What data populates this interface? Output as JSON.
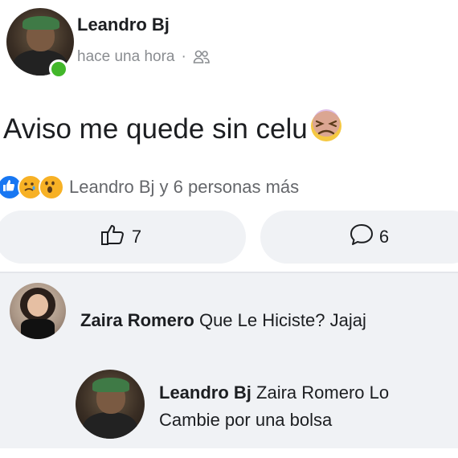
{
  "post": {
    "author": "Leandro Bj",
    "time": "hace una hora",
    "separator": "·",
    "audience_icon": "friends-icon",
    "text": "Aviso me quede sin celu",
    "text_emoji": "tired-face-emoji",
    "reactions": {
      "icons": [
        "like-icon",
        "sad-icon",
        "wow-icon"
      ],
      "summary": "Leandro Bj y 6 personas más"
    },
    "like_count": "7",
    "comment_count": "6"
  },
  "comments": [
    {
      "author": "Zaira Romero",
      "text": "Que Le Hiciste? Jajaj"
    }
  ],
  "reply": {
    "author": "Leandro Bj",
    "mention": "Zaira Romero",
    "text_line1_tail": "Lo",
    "text_line2": "Cambie por una bolsa"
  },
  "colors": {
    "online": "#42b72a",
    "like_blue": "#1877f2",
    "reaction_yellow": "#f7b125",
    "meta_grey": "#8a8d91",
    "comments_bg": "#f0f2f5"
  }
}
